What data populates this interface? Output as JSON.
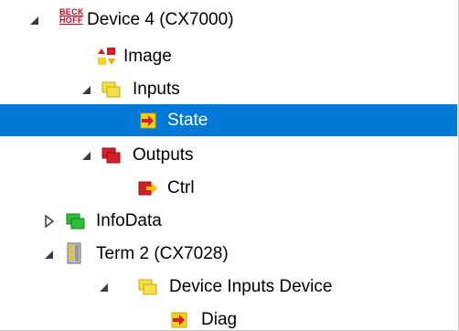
{
  "tree": {
    "root": {
      "label": "Device 4 (CX7000)",
      "logo": [
        "BECK",
        "HOFF"
      ],
      "icon": "beckhoff-logo-icon",
      "expanded": true
    },
    "image": {
      "label": "Image",
      "icon": "image-icon"
    },
    "inputs": {
      "label": "Inputs",
      "icon": "yellow-folder-icon",
      "expanded": true
    },
    "state": {
      "label": "State",
      "icon": "input-arrow-icon",
      "selected": true
    },
    "outputs": {
      "label": "Outputs",
      "icon": "red-folder-icon",
      "expanded": true
    },
    "ctrl": {
      "label": "Ctrl",
      "icon": "output-arrow-icon"
    },
    "infodata": {
      "label": "InfoData",
      "icon": "green-folder-icon",
      "expanded": false
    },
    "term2": {
      "label": "Term 2 (CX7028)",
      "icon": "terminal-icon",
      "expanded": true
    },
    "device_inputs": {
      "label": "Device Inputs Device",
      "icon": "yellow-folder-icon",
      "expanded": true
    },
    "diag": {
      "label": "Diag",
      "icon": "input-arrow-icon"
    }
  },
  "colors": {
    "selection": "#0078d7",
    "inputs_folder": "#f5e04a",
    "outputs_folder": "#d51f26",
    "infodata_folder": "#2dbe3a",
    "brand_red": "#d2001e"
  }
}
